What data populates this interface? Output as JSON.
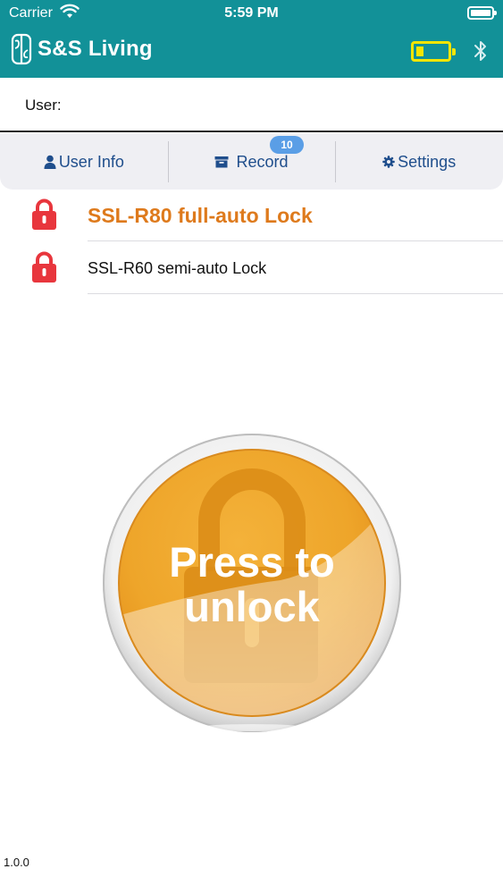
{
  "status_bar": {
    "carrier": "Carrier",
    "time": "5:59 PM"
  },
  "app": {
    "brand": "S&S Living"
  },
  "user": {
    "label": "User:"
  },
  "tabs": [
    {
      "label": "User Info",
      "icon": "person-icon"
    },
    {
      "label": "Record",
      "icon": "archive-box-icon"
    },
    {
      "label": "Settings",
      "icon": "gear-icon"
    }
  ],
  "record_badge": "10",
  "locks": [
    {
      "name": "SSL-R80 full-auto Lock",
      "selected": true
    },
    {
      "name": "SSL-R60 semi-auto Lock",
      "selected": false
    }
  ],
  "unlock_button": {
    "line1": "Press to",
    "line2": "unlock"
  },
  "version": "1.0.0",
  "colors": {
    "header": "#129198",
    "accent_orange": "#de7a1c",
    "tab_text": "#1f4e8c",
    "badge": "#5a9ee6",
    "lock_red": "#e8363d",
    "device_battery": "#f5e500"
  },
  "device_battery_level": 0.25
}
